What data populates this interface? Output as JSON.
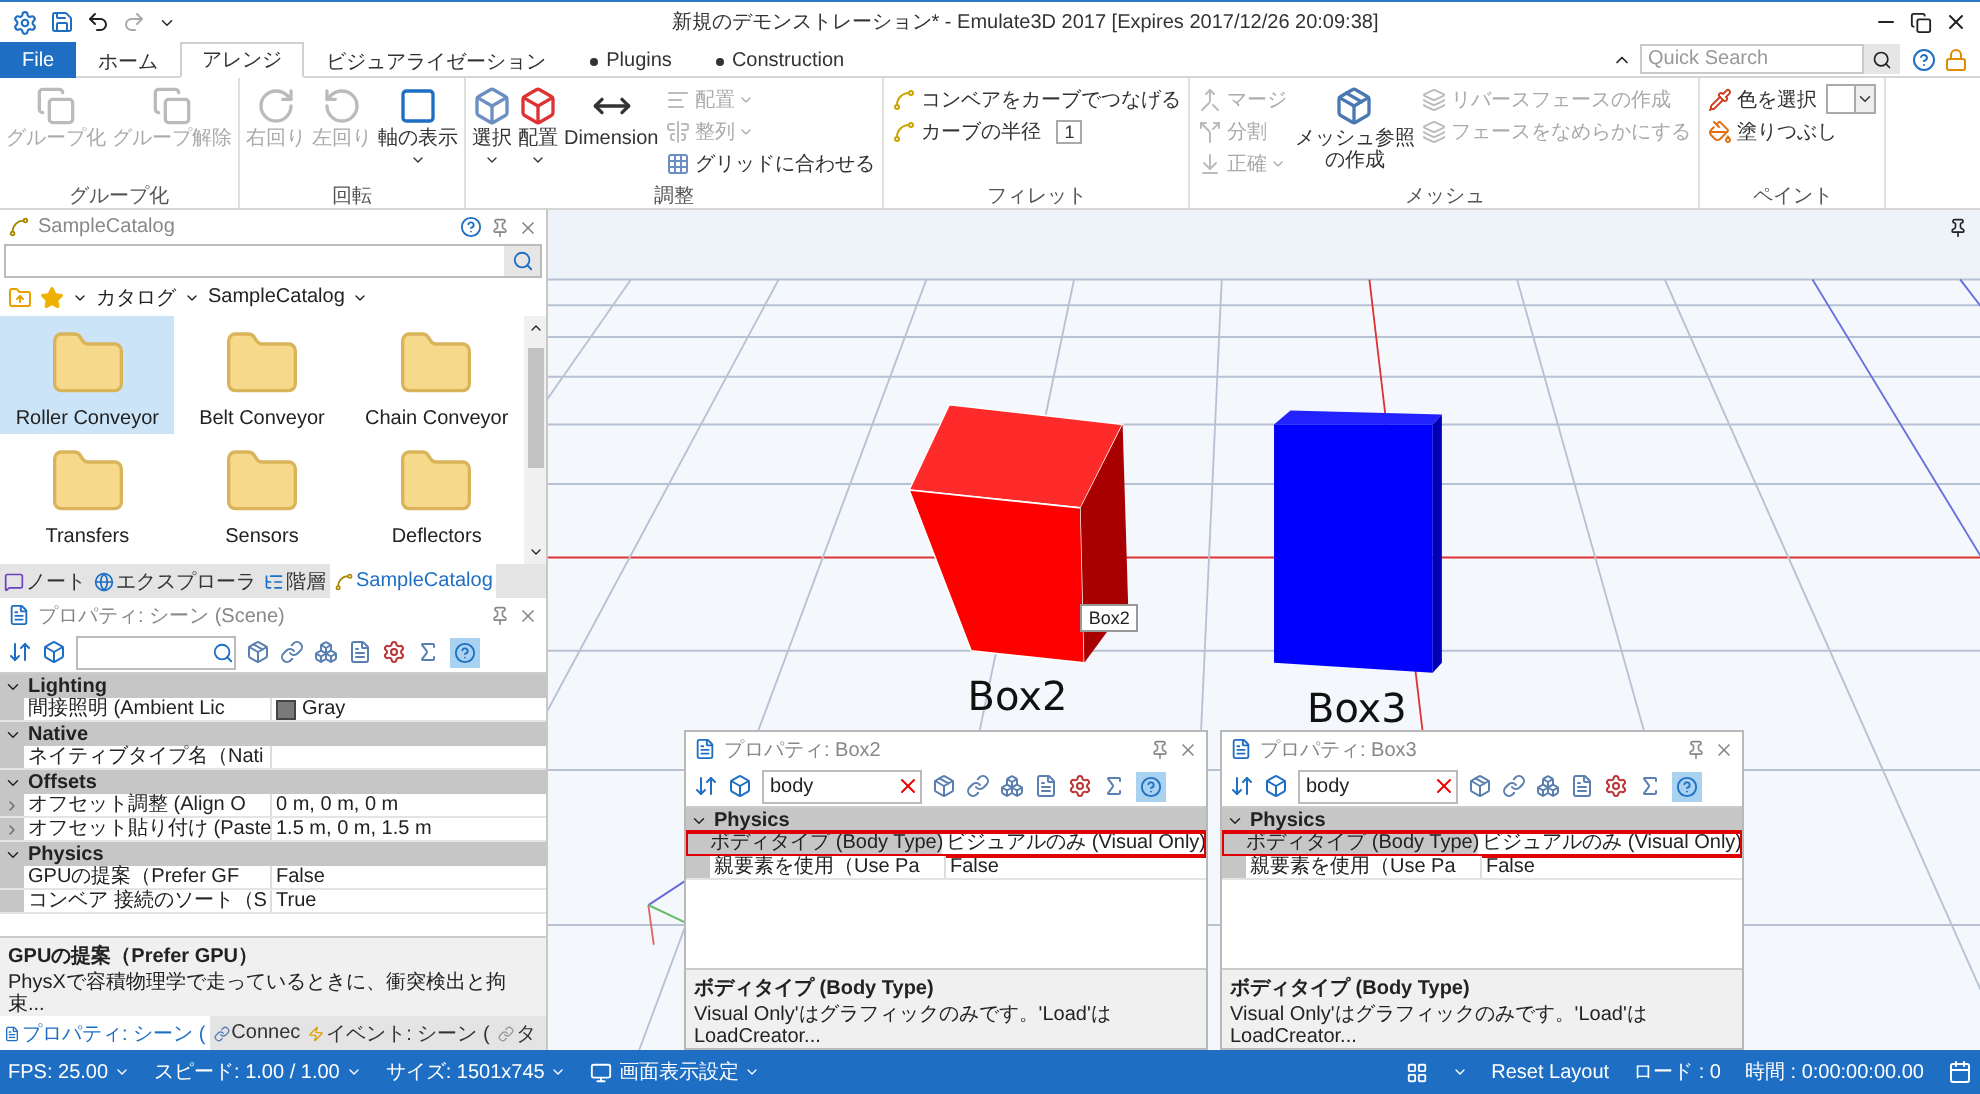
{
  "window": {
    "title": "新規のデモンストレーション* - Emulate3D 2017 [Expires 2017/12/26 20:09:38]"
  },
  "ribbon_tabs": [
    {
      "label": "File",
      "kind": "file",
      "selected": false
    },
    {
      "label": "ホーム",
      "kind": "tab",
      "selected": false
    },
    {
      "label": "アレンジ",
      "kind": "tab",
      "selected": true
    },
    {
      "label": "ビジュアライゼーション",
      "kind": "tab",
      "selected": false
    },
    {
      "label": "Plugins",
      "kind": "plugin",
      "selected": false
    },
    {
      "label": "Construction",
      "kind": "plugin",
      "selected": false
    }
  ],
  "quick_search": {
    "placeholder": "Quick Search"
  },
  "ribbon_groups": [
    {
      "label": "グループ化",
      "items": [
        {
          "label": "グループ化",
          "kind": "large",
          "disabled": true
        },
        {
          "label": "グループ解除",
          "kind": "large",
          "disabled": true
        }
      ]
    },
    {
      "label": "回転",
      "items": [
        {
          "label": "右回り",
          "kind": "large",
          "disabled": true
        },
        {
          "label": "左回り",
          "kind": "large",
          "disabled": true
        },
        {
          "label": "軸の表示",
          "kind": "large",
          "disabled": false,
          "dropdown": true
        }
      ]
    },
    {
      "label": "調整",
      "items": [
        {
          "label": "選択",
          "kind": "large",
          "disabled": false,
          "dropdown": true
        },
        {
          "label": "配置",
          "kind": "large",
          "disabled": false,
          "dropdown": true
        },
        {
          "label": "Dimension",
          "kind": "large",
          "disabled": false
        },
        {
          "label": "配置",
          "kind": "small",
          "disabled": true,
          "dropdown": true
        },
        {
          "label": "整列",
          "kind": "small",
          "disabled": true,
          "dropdown": true
        },
        {
          "label": "グリッドに合わせる",
          "kind": "small",
          "disabled": false
        }
      ]
    },
    {
      "label": "フィレット",
      "items": [
        {
          "label": "コンベアをカーブでつなげる",
          "kind": "small",
          "disabled": false
        },
        {
          "label": "カーブの半径",
          "kind": "small",
          "disabled": false,
          "value": "1"
        }
      ]
    },
    {
      "label": "メッシュ",
      "items": [
        {
          "label": "マージ",
          "kind": "small",
          "disabled": true
        },
        {
          "label": "分割",
          "kind": "small",
          "disabled": true
        },
        {
          "label": "正確",
          "kind": "small",
          "disabled": true,
          "dropdown": true
        },
        {
          "label": "メッシュ参照の作成",
          "kind": "large",
          "disabled": false
        },
        {
          "label": "リバースフェースの作成",
          "kind": "small",
          "disabled": true
        },
        {
          "label": "フェースをなめらかにする",
          "kind": "small",
          "disabled": true
        }
      ]
    },
    {
      "label": "ペイント",
      "items": [
        {
          "label": "色を選択",
          "kind": "small",
          "disabled": false,
          "color": "#ffffff"
        },
        {
          "label": "塗りつぶし",
          "kind": "small",
          "disabled": false
        }
      ]
    }
  ],
  "catalog": {
    "title": "SampleCatalog",
    "breadcrumb": [
      "カタログ",
      "SampleCatalog"
    ],
    "items": [
      {
        "label": "Roller Conveyor",
        "selected": true
      },
      {
        "label": "Belt Conveyor",
        "selected": false
      },
      {
        "label": "Chain Conveyor",
        "selected": false
      },
      {
        "label": "Transfers",
        "selected": false
      },
      {
        "label": "Sensors",
        "selected": false
      },
      {
        "label": "Deflectors",
        "selected": false
      }
    ],
    "tabs": [
      {
        "label": "ノート",
        "selected": false
      },
      {
        "label": "エクスプローラ",
        "selected": false
      },
      {
        "label": "階層",
        "selected": false
      },
      {
        "label": "SampleCatalog",
        "selected": true
      }
    ]
  },
  "scene_properties": {
    "title": "プロパティ: シーン (Scene)",
    "categories": [
      {
        "label": "Lighting",
        "expanded": true,
        "rows": [
          {
            "name": "間接照明 (Ambient Lic",
            "value": "Gray",
            "color": "#7a7a7a",
            "expandable": false
          }
        ]
      },
      {
        "label": "Native",
        "expanded": true,
        "rows": [
          {
            "name": "ネイティブタイプ名（Nati",
            "expandable": false
          }
        ]
      },
      {
        "label": "Offsets",
        "expanded": true,
        "rows": [
          {
            "name": "オフセット調整 (Align O",
            "value": "0 m, 0 m, 0 m",
            "expandable": true
          },
          {
            "name": "オフセット貼り付け (Paste",
            "value": "1.5 m, 0 m, 1.5 m",
            "expandable": true
          }
        ]
      },
      {
        "label": "Physics",
        "expanded": true,
        "rows": [
          {
            "name": "GPUの提案（Prefer GF",
            "value": "False",
            "expandable": false
          },
          {
            "name": "コンベア 接続のソート（S",
            "value": "True",
            "expandable": false
          }
        ]
      }
    ],
    "description": {
      "title": "GPUの提案（Prefer GPU）",
      "text": "PhysXで容積物理学で走っているときに、衝突検出と拘束..."
    },
    "tabs": [
      {
        "label": "プロパティ: シーン (",
        "selected": true
      },
      {
        "label": "Connec",
        "selected": false
      },
      {
        "label": "イベント: シーン (",
        "selected": false
      },
      {
        "label": "タ",
        "selected": false
      }
    ]
  },
  "viewport": {
    "labels": [
      "Box2",
      "Box3"
    ],
    "tooltip": "Box2"
  },
  "property_panels": [
    {
      "title": "プロパティ: Box2",
      "search": "body",
      "categories": [
        {
          "label": "Physics",
          "expanded": true,
          "rows": [
            {
              "name": "ボディタイプ (Body Type)",
              "value": "ビジュアルのみ (Visual Only)",
              "expandable": false,
              "highlighted": true
            },
            {
              "name": "親要素を使用（Use Pa",
              "value": "False",
              "expandable": false,
              "highlighted": false
            }
          ]
        }
      ],
      "description": {
        "title": "ボディタイプ (Body Type)",
        "text": "Visual Only'はグラフィックのみです。'Load'はLoadCreator..."
      }
    },
    {
      "title": "プロパティ: Box3",
      "search": "body",
      "categories": [
        {
          "label": "Physics",
          "expanded": true,
          "rows": [
            {
              "name": "ボディタイプ (Body Type)",
              "value": "ビジュアルのみ (Visual Only)",
              "expandable": false,
              "highlighted": true
            },
            {
              "name": "親要素を使用（Use Pa",
              "value": "False",
              "expandable": false,
              "highlighted": false
            }
          ]
        }
      ],
      "description": {
        "title": "ボディタイプ (Body Type)",
        "text": "Visual Only'はグラフィックのみです。'Load'はLoadCreator..."
      }
    }
  ],
  "status_bar": {
    "left": [
      {
        "label": "FPS: 25.00",
        "kind": "dropdown"
      },
      {
        "label": "スピード: 1.00 / 1.00",
        "kind": "dropdown"
      },
      {
        "label": "サイズ: 1501x745",
        "kind": "dropdown"
      },
      {
        "label": "画面表示設定",
        "kind": "display"
      }
    ],
    "right": [
      {
        "label": "Reset Layout",
        "kind": "layout"
      },
      {
        "label": "ロード : 0",
        "kind": "text"
      },
      {
        "label": "時間 : 0:00:00:00.00",
        "kind": "text"
      }
    ]
  }
}
